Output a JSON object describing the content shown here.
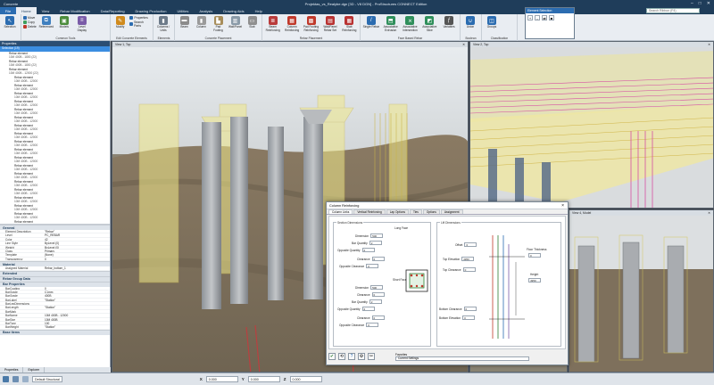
{
  "window": {
    "app_title": "Concrete",
    "doc_title": "Projektas_vs_Realybe.dgn [3D - V8 DGN] - ProStructures CONNECT Edition",
    "controls": [
      "–",
      "□",
      "✕"
    ]
  },
  "menu": {
    "file": "File",
    "tabs": [
      "Home",
      "View",
      "Rebar Modification",
      "Data/Reporting",
      "Drawing Production",
      "Utilities",
      "Analysis",
      "Drawing Aids",
      "Help"
    ],
    "search_placeholder": "Search Ribbon (F4)"
  },
  "ribbon": {
    "groups": [
      {
        "label": "Selection",
        "buttons": [
          {
            "label": "Selection",
            "icon": "cursor-icon",
            "color": "#2b6cb0"
          }
        ]
      },
      {
        "label": "Common Tools",
        "small": [
          "Move",
          "Copy",
          "Delete"
        ],
        "buttons": [
          {
            "label": "Referenced",
            "icon": "reference-icon",
            "color": "#3f7fbf"
          },
          {
            "label": "Models",
            "icon": "models-icon",
            "color": "#4c8c3c"
          },
          {
            "label": "Level Display",
            "icon": "level-icon",
            "color": "#7a5ca8"
          }
        ]
      },
      {
        "label": "Edit Concrete Elements",
        "small": [
          "Properties",
          "Search Parts"
        ],
        "buttons": [
          {
            "label": "Modify",
            "icon": "modify-icon",
            "color": "#d08a1c"
          }
        ]
      },
      {
        "label": "Elements",
        "buttons": [
          {
            "label": "Columns / Units",
            "icon": "column-icon",
            "color": "#6c7a89"
          }
        ]
      },
      {
        "label": "Concrete Placement",
        "buttons": [
          {
            "label": "Beam",
            "icon": "beam-icon",
            "color": "#8b8b8b"
          },
          {
            "label": "Column",
            "icon": "column-icon",
            "color": "#9a9a9a"
          },
          {
            "label": "Pad Footing",
            "icon": "footing-icon",
            "color": "#a78d5a"
          },
          {
            "label": "Wall/Panel",
            "icon": "wall-icon",
            "color": "#8a9aa8"
          },
          {
            "label": "Slab",
            "icon": "slab-icon",
            "color": "#8f8f8f"
          }
        ]
      },
      {
        "label": "Rebar Placement",
        "buttons": [
          {
            "label": "Beam Reinforcing",
            "icon": "rebar-beam-icon",
            "color": "#b93b3b"
          },
          {
            "label": "Column Reinforcing",
            "icon": "rebar-column-icon",
            "color": "#c0392b"
          },
          {
            "label": "Pad Footing Reinforcing",
            "icon": "rebar-footing-icon",
            "color": "#c0392b"
          },
          {
            "label": "Wall/Panel Rebar Set",
            "icon": "rebar-wall-icon",
            "color": "#b83232"
          },
          {
            "label": "Slab Reinforcing",
            "icon": "rebar-slab-icon",
            "color": "#b83232"
          }
        ]
      },
      {
        "label": "Face Based Rebar",
        "buttons": [
          {
            "label": "Single Rebar",
            "icon": "single-rebar-icon",
            "color": "#2b6cb0"
          },
          {
            "label": "Associative Extrusion",
            "icon": "extrusion-icon",
            "color": "#2f8f5b"
          },
          {
            "label": "Associative Intersection",
            "icon": "intersection-icon",
            "color": "#2f8f5b"
          },
          {
            "label": "Associative Slice",
            "icon": "slice-icon",
            "color": "#2f8f5b"
          },
          {
            "label": "Variables",
            "icon": "fx-icon",
            "color": "#555555"
          }
        ]
      },
      {
        "label": "Boolean",
        "buttons": [
          {
            "label": "Union",
            "icon": "union-icon",
            "color": "#2b6cb0"
          }
        ]
      },
      {
        "label": "Classification",
        "buttons": [
          {
            "label": "Groups",
            "icon": "groups-icon",
            "color": "#2b6cb0"
          }
        ]
      }
    ]
  },
  "element_selection": {
    "title": "Element Selection",
    "buttons": [
      "+",
      "–",
      "⇄",
      "■"
    ]
  },
  "side_panel": {
    "title": "Properties",
    "tree": [
      {
        "label": "Selection (19)",
        "sub": "",
        "selected": true,
        "level": 0
      },
      {
        "label": "Rebar element",
        "sub": "10M 400B - 1800 (22)",
        "level": 1
      },
      {
        "label": "Rebar element",
        "sub": "10M 400B - 1800 (22)",
        "level": 1
      },
      {
        "label": "Rebar element",
        "sub": "10M 400B - 12000 (22)",
        "level": 1
      },
      {
        "label": "Rebar element",
        "sub": "10M 400B - 12000",
        "level": 2
      },
      {
        "label": "Rebar element",
        "sub": "10M 400B - 12000",
        "level": 2
      },
      {
        "label": "Rebar element",
        "sub": "10M 400B - 12000",
        "level": 2
      },
      {
        "label": "Rebar element",
        "sub": "10M 400B - 12000",
        "level": 2
      },
      {
        "label": "Rebar element",
        "sub": "10M 400B - 12000",
        "level": 2
      },
      {
        "label": "Rebar element",
        "sub": "10M 400B - 12000",
        "level": 2
      },
      {
        "label": "Rebar element",
        "sub": "10M 400B - 12000",
        "level": 2
      },
      {
        "label": "Rebar element",
        "sub": "10M 400B - 12000",
        "level": 2
      },
      {
        "label": "Rebar element",
        "sub": "10M 400B - 12000",
        "level": 2
      },
      {
        "label": "Rebar element",
        "sub": "10M 400B - 12000",
        "level": 2
      },
      {
        "label": "Rebar element",
        "sub": "10M 400B - 12000",
        "level": 2
      },
      {
        "label": "Rebar element",
        "sub": "10M 400B - 12000",
        "level": 2
      },
      {
        "label": "Rebar element",
        "sub": "10M 400B - 12000",
        "level": 2
      },
      {
        "label": "Rebar element",
        "sub": "10M 400B - 12000",
        "level": 2
      },
      {
        "label": "Rebar element",
        "sub": "10M 400B - 12000",
        "level": 2
      },
      {
        "label": "Rebar element",
        "sub": "10M 400B - 12000",
        "level": 2
      },
      {
        "label": "Rebar element",
        "sub": "10M 400B - 12000",
        "level": 2
      },
      {
        "label": "Rebar element",
        "sub": "10M 400B - 12000",
        "level": 2
      },
      {
        "label": "Rebar element",
        "sub": "10M 400B - 12000",
        "level": 2
      }
    ],
    "sections": [
      {
        "title": "General",
        "rows": [
          [
            "Element Description",
            "\"Rebar\""
          ],
          [
            "Level",
            "PC_REBAR"
          ],
          [
            "Color",
            "42"
          ],
          [
            "Line Style",
            "ByLevel (0)"
          ],
          [
            "Weight",
            "ByLevel (0)"
          ],
          [
            "Class",
            "Primary"
          ],
          [
            "Template",
            "(None)"
          ],
          [
            "Transparency",
            "0"
          ]
        ]
      },
      {
        "title": "Material",
        "rows": [
          [
            "Assigned Material",
            "Rebar_bottom_1"
          ]
        ]
      },
      {
        "title": "Extended",
        "rows": []
      },
      {
        "title": "Rebar Group Data",
        "rows": []
      },
      {
        "title": "Bar Properties",
        "rows": [
          [
            "BarCoating",
            "0"
          ],
          [
            "BarGrade",
            "C1mm"
          ],
          [
            "BarGrade",
            "400B"
          ],
          [
            "BarLabel",
            "\"Station\""
          ],
          [
            "BarLegDimensions",
            ""
          ],
          [
            "BarLength",
            "\"Station\""
          ],
          [
            "BarMark",
            ""
          ],
          [
            "BarName",
            "10M 400B - 12000"
          ],
          [
            "BarSize",
            "10M 400B"
          ],
          [
            "BarType",
            "100"
          ],
          [
            "BarWeight",
            "\"Station\""
          ]
        ]
      },
      {
        "title": "Base Items",
        "rows": []
      }
    ],
    "tabs": [
      "Properties",
      "Explorer"
    ]
  },
  "views": [
    {
      "title": "View 1, Top"
    },
    {
      "title": "View 2, Top"
    },
    {
      "title": "View 3, Model"
    },
    {
      "title": "View 4, Model"
    }
  ],
  "dialog": {
    "title": "Column Reinforcing",
    "tabs": [
      "Column Links",
      "Vertical Reinforcing",
      "Lap Options",
      "Ties",
      "Options",
      "Assignment"
    ],
    "section_dims": "Section Dimensions",
    "long_face": "Long Face",
    "short_face": "Short Face",
    "long_rows": [
      [
        "Dimension",
        "500"
      ],
      [
        "Bar Quantity",
        "2"
      ],
      [
        "Opposite Quantity",
        "2"
      ],
      [
        "Clearance",
        "0"
      ],
      [
        "Opposite Clearance",
        "0"
      ]
    ],
    "short_rows": [
      [
        "Dimension",
        "500"
      ],
      [
        "Clearance",
        "0"
      ],
      [
        "Bar Quantity",
        "2"
      ],
      [
        "Opposite Quantity",
        "2"
      ],
      [
        "Clearance",
        "0"
      ],
      [
        "Opposite Clearance",
        "0"
      ]
    ],
    "lift_dims": "Lift Dimensions",
    "lift_rows": [
      [
        "Offset",
        "0"
      ],
      [
        "Top Elevation",
        "4950"
      ],
      [
        "Top Clearance",
        "0"
      ],
      [
        "Bottom Clearance",
        "0"
      ],
      [
        "Bottom Elevation",
        "0"
      ]
    ],
    "floor_thickness": "Floor Thickness",
    "floor_val": "0",
    "height_label": "Height",
    "height_val": "4950",
    "favorites_label": "Favorites",
    "favorites_value": "Current Settings",
    "footer_buttons": [
      "✔",
      "⟲",
      "?",
      "⚙",
      "✂"
    ]
  },
  "status": {
    "prompt": "Default Structural",
    "x_label": "X",
    "x_value": "0.000",
    "y_label": "Y",
    "y_value": "0.000",
    "z_label": "Z",
    "z_value": "0.000"
  }
}
